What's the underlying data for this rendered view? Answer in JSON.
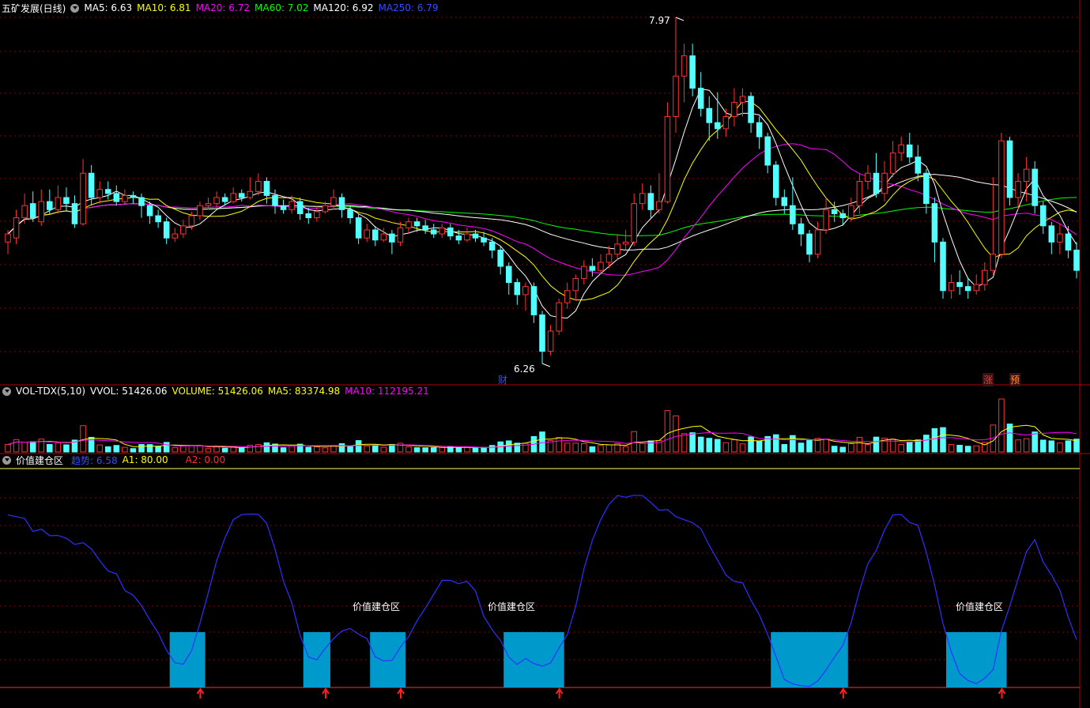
{
  "main_panel": {
    "title": "五矿发展(日线)",
    "ma_labels": [
      {
        "text": "MA5: 6.63",
        "color": "#ffffff"
      },
      {
        "text": "MA10: 6.81",
        "color": "#ffff00"
      },
      {
        "text": "MA20: 6.72",
        "color": "#ff00ff"
      },
      {
        "text": "MA60: 7.02",
        "color": "#00ff00"
      },
      {
        "text": "MA120: 6.92",
        "color": "#ffffff"
      },
      {
        "text": "MA250: 6.79",
        "color": "#3050ff"
      }
    ],
    "high_label": "7.97",
    "low_label": "6.26",
    "marker_cai": "财",
    "marker_zhang": "涨",
    "marker_yu": "预"
  },
  "volume_panel": {
    "title": "VOL-TDX(5,10)",
    "labels": [
      {
        "text": "VVOL: 51426.06",
        "color": "#ffffff"
      },
      {
        "text": "VOLUME: 51426.06",
        "color": "#ffff00"
      },
      {
        "text": "MA5: 83374.98",
        "color": "#ffff00"
      },
      {
        "text": "MA10: 112195.21",
        "color": "#ff00ff"
      }
    ]
  },
  "indicator_panel": {
    "title": "价值建仓区",
    "labels": [
      {
        "text": "趋势: 6.58",
        "color": "#3050ff"
      },
      {
        "text": "A1: 80.00",
        "color": "#ffff00"
      },
      {
        "text": "A2: 0.00",
        "color": "#ff3030"
      }
    ],
    "zone_label": "价值建仓区"
  },
  "colors": {
    "up": "#ff3232",
    "down": "#54ffff",
    "grid": "#8b0000",
    "trend": "#3030ff",
    "zone": "#0099cc"
  },
  "chart_data": {
    "type": "candlestick",
    "title": "五矿发展(日线)",
    "price_range": [
      6.26,
      7.97
    ],
    "high": 7.97,
    "low": 6.26,
    "ma_current": {
      "MA5": 6.63,
      "MA10": 6.81,
      "MA20": 6.72,
      "MA60": 7.02,
      "MA120": 6.92,
      "MA250": 6.79
    },
    "volume_current": {
      "VVOL": 51426.06,
      "VOLUME": 51426.06,
      "MA5": 83374.98,
      "MA10": 112195.21
    },
    "indicator_current": {
      "趋势": 6.58,
      "A1": 80.0,
      "A2": 0.0
    },
    "candles": [
      [
        6.86,
        6.9,
        6.92,
        6.8
      ],
      [
        6.88,
        6.98,
        7.02,
        6.85
      ],
      [
        6.98,
        7.04,
        7.1,
        6.95
      ],
      [
        7.05,
        6.98,
        7.11,
        6.96
      ],
      [
        6.96,
        7.06,
        7.12,
        6.94
      ],
      [
        7.06,
        7.02,
        7.12,
        7.0
      ],
      [
        7.02,
        7.08,
        7.14,
        7.0
      ],
      [
        7.08,
        7.05,
        7.13,
        7.01
      ],
      [
        7.05,
        6.95,
        7.09,
        6.93
      ],
      [
        6.95,
        7.2,
        7.27,
        6.94
      ],
      [
        7.2,
        7.08,
        7.24,
        7.04
      ],
      [
        7.08,
        7.12,
        7.16,
        7.05
      ],
      [
        7.12,
        7.1,
        7.16,
        7.07
      ],
      [
        7.1,
        7.06,
        7.14,
        7.04
      ],
      [
        7.06,
        7.09,
        7.12,
        7.05
      ],
      [
        7.09,
        7.08,
        7.11,
        7.05
      ],
      [
        7.08,
        7.04,
        7.1,
        6.98
      ],
      [
        7.04,
        6.99,
        7.06,
        6.95
      ],
      [
        6.99,
        6.96,
        7.02,
        6.93
      ],
      [
        6.96,
        6.88,
        6.98,
        6.85
      ],
      [
        6.88,
        6.9,
        6.93,
        6.86
      ],
      [
        6.9,
        6.94,
        6.97,
        6.88
      ],
      [
        6.94,
        6.99,
        7.01,
        6.92
      ],
      [
        6.99,
        7.04,
        7.06,
        6.97
      ],
      [
        7.04,
        7.05,
        7.08,
        7.02
      ],
      [
        7.05,
        7.08,
        7.11,
        7.03
      ],
      [
        7.08,
        7.06,
        7.1,
        7.04
      ],
      [
        7.06,
        7.1,
        7.13,
        7.05
      ],
      [
        7.1,
        7.08,
        7.12,
        7.06
      ],
      [
        7.08,
        7.11,
        7.18,
        7.07
      ],
      [
        7.11,
        7.16,
        7.2,
        7.09
      ],
      [
        7.16,
        7.09,
        7.18,
        7.05
      ],
      [
        7.09,
        7.04,
        7.12,
        7.0
      ],
      [
        7.04,
        7.02,
        7.07,
        7.0
      ],
      [
        7.02,
        7.06,
        7.09,
        7.0
      ],
      [
        7.06,
        7.0,
        7.08,
        6.97
      ],
      [
        7.0,
        6.98,
        7.03,
        6.95
      ],
      [
        6.98,
        7.01,
        7.04,
        6.96
      ],
      [
        7.01,
        7.04,
        7.06,
        7.0
      ],
      [
        7.04,
        7.08,
        7.12,
        7.02
      ],
      [
        7.08,
        7.02,
        7.1,
        6.98
      ],
      [
        7.02,
        6.98,
        7.04,
        6.95
      ],
      [
        6.98,
        6.88,
        7.0,
        6.85
      ],
      [
        6.88,
        6.92,
        6.95,
        6.86
      ],
      [
        6.92,
        6.87,
        6.94,
        6.84
      ],
      [
        6.87,
        6.9,
        6.93,
        6.86
      ],
      [
        6.9,
        6.86,
        6.92,
        6.8
      ],
      [
        6.86,
        6.93,
        6.96,
        6.84
      ],
      [
        6.93,
        6.96,
        6.98,
        6.9
      ],
      [
        6.96,
        6.94,
        6.98,
        6.91
      ],
      [
        6.94,
        6.92,
        6.97,
        6.9
      ],
      [
        6.92,
        6.9,
        6.95,
        6.88
      ],
      [
        6.9,
        6.93,
        6.95,
        6.88
      ],
      [
        6.93,
        6.89,
        6.95,
        6.87
      ],
      [
        6.89,
        6.87,
        6.92,
        6.85
      ],
      [
        6.87,
        6.9,
        6.93,
        6.86
      ],
      [
        6.9,
        6.88,
        6.92,
        6.86
      ],
      [
        6.88,
        6.86,
        6.91,
        6.84
      ],
      [
        6.86,
        6.82,
        6.88,
        6.78
      ],
      [
        6.82,
        6.74,
        6.84,
        6.7
      ],
      [
        6.74,
        6.66,
        6.76,
        6.6
      ],
      [
        6.66,
        6.6,
        6.68,
        6.55
      ],
      [
        6.6,
        6.64,
        6.66,
        6.52
      ],
      [
        6.64,
        6.5,
        6.66,
        6.46
      ],
      [
        6.5,
        6.32,
        6.52,
        6.26
      ],
      [
        6.32,
        6.42,
        6.45,
        6.3
      ],
      [
        6.42,
        6.56,
        6.58,
        6.4
      ],
      [
        6.56,
        6.62,
        6.66,
        6.53
      ],
      [
        6.62,
        6.68,
        6.7,
        6.57
      ],
      [
        6.68,
        6.74,
        6.77,
        6.65
      ],
      [
        6.74,
        6.72,
        6.78,
        6.69
      ],
      [
        6.72,
        6.76,
        6.8,
        6.7
      ],
      [
        6.76,
        6.8,
        6.84,
        6.73
      ],
      [
        6.8,
        6.85,
        6.9,
        6.77
      ],
      [
        6.85,
        6.86,
        6.92,
        6.82
      ],
      [
        6.86,
        7.05,
        7.1,
        6.84
      ],
      [
        7.05,
        7.1,
        7.15,
        7.02
      ],
      [
        7.1,
        7.02,
        7.14,
        6.98
      ],
      [
        7.02,
        7.06,
        7.2,
        7.0
      ],
      [
        7.06,
        7.48,
        7.55,
        7.05
      ],
      [
        7.48,
        7.68,
        7.97,
        7.4
      ],
      [
        7.68,
        7.78,
        7.84,
        7.55
      ],
      [
        7.78,
        7.62,
        7.84,
        7.58
      ],
      [
        7.62,
        7.52,
        7.7,
        7.48
      ],
      [
        7.52,
        7.45,
        7.58,
        7.36
      ],
      [
        7.45,
        7.42,
        7.6,
        7.37
      ],
      [
        7.42,
        7.48,
        7.52,
        7.38
      ],
      [
        7.48,
        7.55,
        7.62,
        7.43
      ],
      [
        7.55,
        7.58,
        7.62,
        7.48
      ],
      [
        7.58,
        7.45,
        7.6,
        7.4
      ],
      [
        7.45,
        7.38,
        7.48,
        7.32
      ],
      [
        7.38,
        7.24,
        7.4,
        7.2
      ],
      [
        7.24,
        7.08,
        7.26,
        7.04
      ],
      [
        7.08,
        7.04,
        7.12,
        7.0
      ],
      [
        7.04,
        6.95,
        7.18,
        6.92
      ],
      [
        6.95,
        6.9,
        6.98,
        6.84
      ],
      [
        6.9,
        6.8,
        6.92,
        6.76
      ],
      [
        6.8,
        6.92,
        6.96,
        6.78
      ],
      [
        6.92,
        7.02,
        7.08,
        6.9
      ],
      [
        7.02,
        7.0,
        7.06,
        6.96
      ],
      [
        7.0,
        6.98,
        7.02,
        6.94
      ],
      [
        6.98,
        7.04,
        7.08,
        6.96
      ],
      [
        7.04,
        7.16,
        7.2,
        7.0
      ],
      [
        7.16,
        7.2,
        7.24,
        7.12
      ],
      [
        7.2,
        7.1,
        7.3,
        7.08
      ],
      [
        7.1,
        7.2,
        7.26,
        7.06
      ],
      [
        7.2,
        7.3,
        7.36,
        7.18
      ],
      [
        7.3,
        7.34,
        7.38,
        7.26
      ],
      [
        7.34,
        7.28,
        7.4,
        7.25
      ],
      [
        7.28,
        7.2,
        7.34,
        7.16
      ],
      [
        7.2,
        7.05,
        7.22,
        7.0
      ],
      [
        7.05,
        6.86,
        7.08,
        6.76
      ],
      [
        6.86,
        6.62,
        6.88,
        6.58
      ],
      [
        6.62,
        6.66,
        6.7,
        6.58
      ],
      [
        6.66,
        6.64,
        6.72,
        6.6
      ],
      [
        6.64,
        6.62,
        6.68,
        6.58
      ],
      [
        6.62,
        6.65,
        6.7,
        6.6
      ],
      [
        6.65,
        6.72,
        6.76,
        6.62
      ],
      [
        6.72,
        6.8,
        7.18,
        6.7
      ],
      [
        6.8,
        7.36,
        7.4,
        6.78
      ],
      [
        7.36,
        7.08,
        7.38,
        7.04
      ],
      [
        7.08,
        7.16,
        7.2,
        7.02
      ],
      [
        7.16,
        7.22,
        7.28,
        7.06
      ],
      [
        7.22,
        7.04,
        7.26,
        7.0
      ],
      [
        7.04,
        6.94,
        7.06,
        6.9
      ],
      [
        6.94,
        6.86,
        6.96,
        6.8
      ],
      [
        6.86,
        6.9,
        6.95,
        6.8
      ],
      [
        6.9,
        6.82,
        6.94,
        6.78
      ],
      [
        6.82,
        6.72,
        6.86,
        6.68
      ]
    ]
  }
}
